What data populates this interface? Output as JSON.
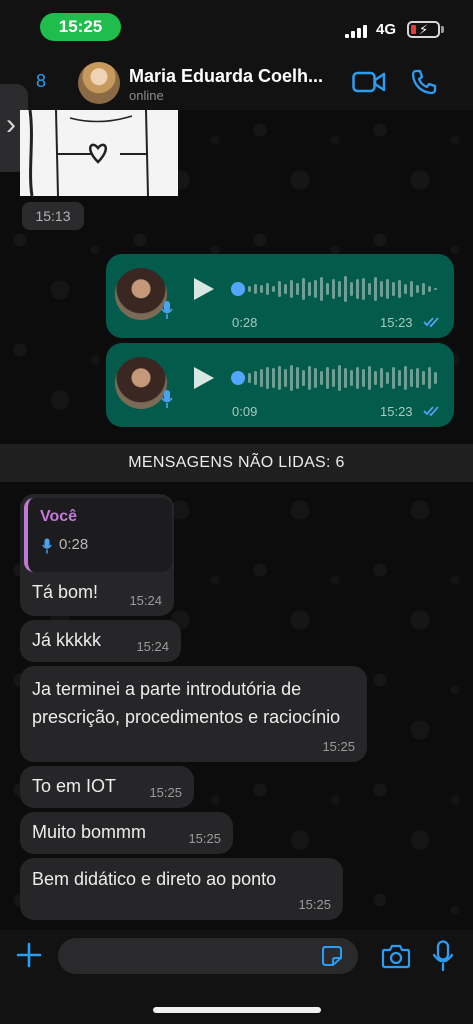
{
  "status_bar": {
    "time": "15:25",
    "network": "4G"
  },
  "header": {
    "back_count": "8",
    "contact_name": "Maria Eduarda Coelh...",
    "contact_status": "online"
  },
  "messages": {
    "image_time": "15:13",
    "audio": [
      {
        "duration": "0:28",
        "time": "15:23"
      },
      {
        "duration": "0:09",
        "time": "15:23"
      }
    ],
    "unread_banner": "MENSAGENS NÃO LIDAS: 6",
    "quoted": {
      "author": "Você",
      "duration": "0:28"
    },
    "incoming": [
      {
        "text": "Tá bom!",
        "time": "15:24"
      },
      {
        "text": "Já kkkkk",
        "time": "15:24"
      },
      {
        "text": "Ja terminei a parte introdutória de prescrição, procedimentos e raciocínio",
        "time": "15:25"
      },
      {
        "text": "To em IOT",
        "time": "15:25"
      },
      {
        "text": "Muito bommm",
        "time": "15:25"
      },
      {
        "text": "Bem didático e direto ao ponto",
        "time": "15:25"
      }
    ]
  },
  "composer": {
    "placeholder": ""
  },
  "colors": {
    "accent": "#2a9df4",
    "outgoing_bubble": "#035c4b",
    "incoming_bubble": "#262628",
    "quote_accent": "#c279d6"
  }
}
